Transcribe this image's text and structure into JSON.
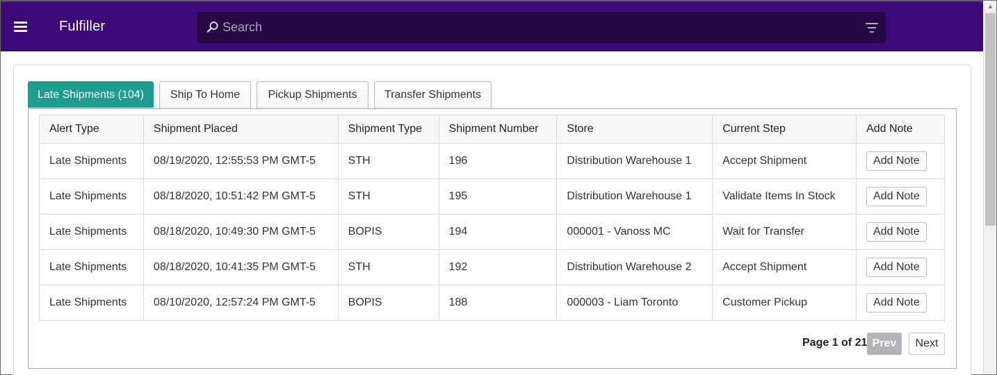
{
  "app": {
    "title": "Fulfiller"
  },
  "search": {
    "placeholder": "Search",
    "value": ""
  },
  "tabs": [
    {
      "label": "Late Shipments (104)",
      "active": true
    },
    {
      "label": "Ship To Home",
      "active": false
    },
    {
      "label": "Pickup Shipments",
      "active": false
    },
    {
      "label": "Transfer Shipments",
      "active": false
    }
  ],
  "table": {
    "headers": [
      "Alert Type",
      "Shipment Placed",
      "Shipment Type",
      "Shipment Number",
      "Store",
      "Current Step",
      "Add Note"
    ],
    "rows": [
      {
        "alert": "Late Shipments",
        "placed": "08/19/2020, 12:55:53 PM GMT-5",
        "type": "STH",
        "number": "196",
        "store": "Distribution Warehouse 1",
        "step": "Accept Shipment",
        "note": "Add Note"
      },
      {
        "alert": "Late Shipments",
        "placed": "08/18/2020, 10:51:42 PM GMT-5",
        "type": "STH",
        "number": "195",
        "store": "Distribution Warehouse 1",
        "step": "Validate Items In Stock",
        "note": "Add Note"
      },
      {
        "alert": "Late Shipments",
        "placed": "08/18/2020, 10:49:30 PM GMT-5",
        "type": "BOPIS",
        "number": "194",
        "store": "000001 - Vanoss MC",
        "step": "Wait for Transfer",
        "note": "Add Note"
      },
      {
        "alert": "Late Shipments",
        "placed": "08/18/2020, 10:41:35 PM GMT-5",
        "type": "STH",
        "number": "192",
        "store": "Distribution Warehouse 2",
        "step": "Accept Shipment",
        "note": "Add Note"
      },
      {
        "alert": "Late Shipments",
        "placed": "08/10/2020, 12:57:24 PM GMT-5",
        "type": "BOPIS",
        "number": "188",
        "store": "000003 - Liam Toronto",
        "step": "Customer Pickup",
        "note": "Add Note"
      }
    ]
  },
  "pager": {
    "text": "Page 1 of 21",
    "prev": "Prev",
    "next": "Next"
  },
  "colors": {
    "header": "#3c0a78",
    "search_bg": "#250944",
    "active_tab": "#1f9c90",
    "disabled_button": "#b1b4b8"
  },
  "icons": {
    "menu": "hamburger-icon",
    "search": "search-icon",
    "filter": "filter-icon"
  }
}
